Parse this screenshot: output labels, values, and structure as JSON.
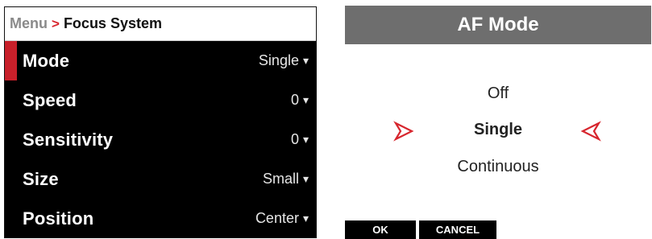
{
  "breadcrumb": {
    "menu": "Menu",
    "separator": ">",
    "current": "Focus System"
  },
  "menu_items": [
    {
      "label": "Mode",
      "value": "Single",
      "selected": true
    },
    {
      "label": "Speed",
      "value": "0",
      "selected": false
    },
    {
      "label": "Sensitivity",
      "value": "0",
      "selected": false
    },
    {
      "label": "Size",
      "value": "Small",
      "selected": false
    },
    {
      "label": "Position",
      "value": "Center",
      "selected": false
    }
  ],
  "caret_glyph": "▾",
  "dialog": {
    "title": "AF Mode",
    "options": [
      "Off",
      "Single",
      "Continuous"
    ],
    "selected": "Single",
    "softkeys": {
      "ok": "OK",
      "cancel": "CANCEL"
    }
  },
  "colors": {
    "accent_red": "#c8202a",
    "panel_bg": "#000000",
    "dialog_title_bg": "#6e6e6e"
  },
  "icons": {
    "left_selector": "triangle-right-outline-icon",
    "right_selector": "triangle-left-outline-icon"
  }
}
